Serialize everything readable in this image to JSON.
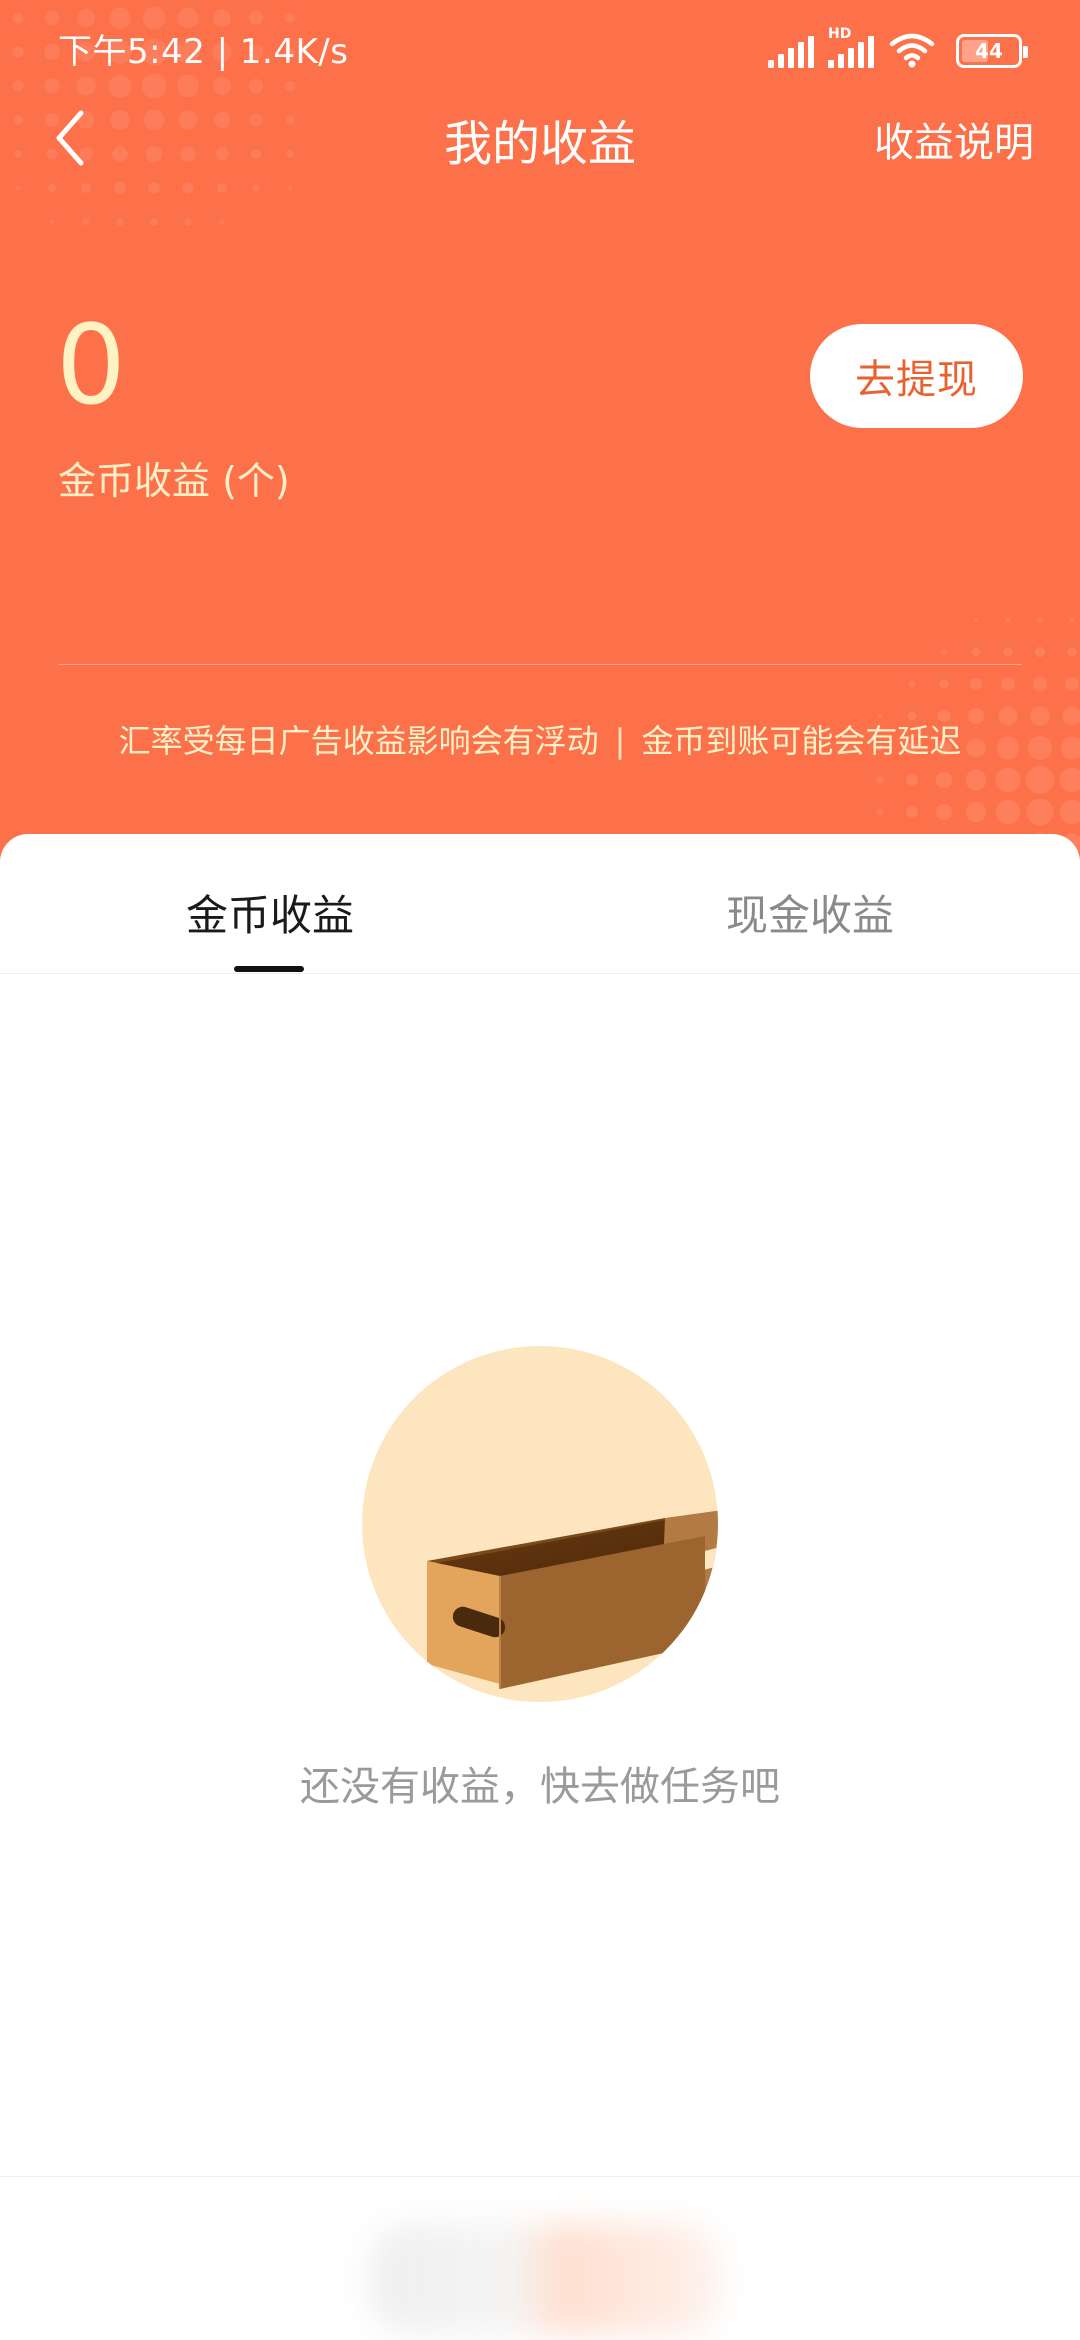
{
  "status_bar": {
    "time_speed": "下午5:42 | 1.4K/s",
    "hd_label": "HD",
    "battery": "44"
  },
  "nav": {
    "back_icon": "chevron-left-icon",
    "title": "我的收益",
    "help": "收益说明"
  },
  "balance": {
    "value": "0",
    "label": "金币收益 (个)",
    "withdraw_button": "去提现"
  },
  "notice": {
    "left": "汇率受每日广告收益影响会有浮动",
    "separator": "|",
    "right": "金币到账可能会有延迟"
  },
  "tabs": {
    "items": [
      {
        "label": "金币收益",
        "selected": true
      },
      {
        "label": "现金收益",
        "selected": false
      }
    ]
  },
  "empty_state": {
    "icon": "empty-box-icon",
    "message": "还没有收益，快去做任务吧"
  },
  "colors": {
    "header_orange": "#fd714a",
    "balance_yellow": "#fff3c4",
    "button_text_orange": "#e8622f",
    "illustration_circle": "#fde6bf"
  }
}
